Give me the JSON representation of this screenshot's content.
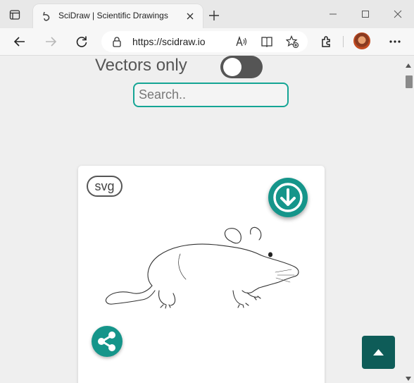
{
  "browser": {
    "tab_title": "SciDraw | Scientific Drawings",
    "url": "https://scidraw.io",
    "icons": [
      "tab-actions-icon",
      "scidraw-favicon",
      "close-icon",
      "plus-icon",
      "minimize-icon",
      "maximize-icon",
      "close-window-icon",
      "back-icon",
      "forward-icon",
      "refresh-icon",
      "lock-icon",
      "read-aloud-icon",
      "reader-view-icon",
      "add-favorite-icon",
      "extensions-icon",
      "profile-avatar",
      "more-icon"
    ]
  },
  "filters": {
    "vectors_only_label": "Vectors only",
    "vectors_only_enabled": false,
    "search_placeholder": "Search..",
    "search_value": ""
  },
  "card": {
    "format_badge": "svg",
    "image_subject": "mouse drawing",
    "icons": [
      "download-icon",
      "share-icon"
    ]
  },
  "colors": {
    "accent": "#15a595",
    "button_teal": "#15958a",
    "scroll_top_button": "#0e5c58",
    "toggle_off": "#555555"
  },
  "page_controls": {
    "icons": [
      "scroll-to-top-icon"
    ]
  }
}
